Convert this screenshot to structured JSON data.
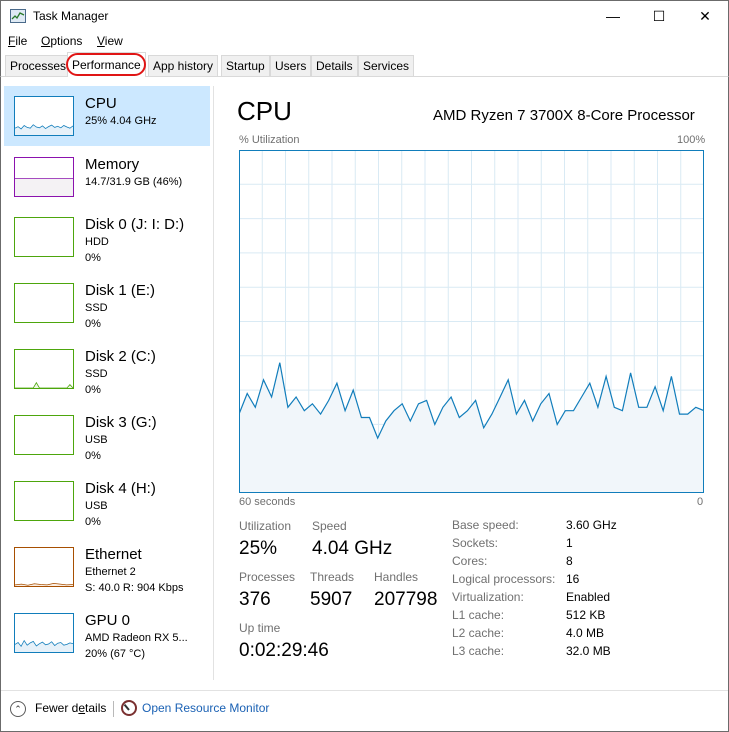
{
  "window": {
    "title": "Task Manager",
    "icon": "task-manager-icon",
    "minimize_glyph": "—",
    "maximize_glyph": "☐",
    "close_glyph": "✕"
  },
  "menu": [
    {
      "ul": "F",
      "rest": "ile"
    },
    {
      "ul": "O",
      "rest": "ptions"
    },
    {
      "ul": "V",
      "rest": "iew"
    }
  ],
  "tabs": [
    "Processes",
    "Performance",
    "App history",
    "Startup",
    "Users",
    "Details",
    "Services"
  ],
  "active_tab": "Performance",
  "sidebar": [
    {
      "name": "CPU",
      "line1": "25% 4.04 GHz",
      "line2": "",
      "color": "#117dbb"
    },
    {
      "name": "Memory",
      "line1": "14.7/31.9 GB (46%)",
      "line2": "",
      "color": "#8b12ae"
    },
    {
      "name": "Disk 0 (J: I: D:)",
      "line1": "HDD",
      "line2": "0%",
      "color": "#4da60c"
    },
    {
      "name": "Disk 1 (E:)",
      "line1": "SSD",
      "line2": "0%",
      "color": "#4da60c"
    },
    {
      "name": "Disk 2 (C:)",
      "line1": "SSD",
      "line2": "0%",
      "color": "#4da60c"
    },
    {
      "name": "Disk 3 (G:)",
      "line1": "USB",
      "line2": "0%",
      "color": "#4da60c"
    },
    {
      "name": "Disk 4 (H:)",
      "line1": "USB",
      "line2": "0%",
      "color": "#4da60c"
    },
    {
      "name": "Ethernet",
      "line1": "Ethernet 2",
      "line2": "S: 40.0 R: 904 Kbps",
      "color": "#a74f01"
    },
    {
      "name": "GPU 0",
      "line1": "AMD Radeon RX 5...",
      "line2": "20% (67 °C)",
      "color": "#117dbb"
    }
  ],
  "main": {
    "title": "CPU",
    "model": "AMD Ryzen 7 3700X 8-Core Processor",
    "util_label": "% Utilization",
    "max_label": "100%",
    "seconds_label": "60 seconds",
    "zero_label": "0",
    "accent": "#117dbb",
    "fill": "#f1f6fa",
    "grid_color": "#d9eaf4"
  },
  "stats": {
    "utilization_label": "Utilization",
    "utilization": "25%",
    "speed_label": "Speed",
    "speed": "4.04 GHz",
    "processes_label": "Processes",
    "processes": "376",
    "threads_label": "Threads",
    "threads": "5907",
    "handles_label": "Handles",
    "handles": "207798",
    "uptime_label": "Up time",
    "uptime": "0:02:29:46"
  },
  "specs": [
    {
      "label": "Base speed:",
      "value": "3.60 GHz"
    },
    {
      "label": "Sockets:",
      "value": "1"
    },
    {
      "label": "Cores:",
      "value": "8"
    },
    {
      "label": "Logical processors:",
      "value": "16"
    },
    {
      "label": "Virtualization:",
      "value": "Enabled"
    },
    {
      "label": "L1 cache:",
      "value": "512 KB"
    },
    {
      "label": "L2 cache:",
      "value": "4.0 MB"
    },
    {
      "label": "L3 cache:",
      "value": "32.0 MB"
    }
  ],
  "footer": {
    "fewer_details": "Fewer details",
    "fewer_details_underline_index": 7,
    "open_resource_monitor": "Open Resource Monitor"
  },
  "chart_data": {
    "type": "line",
    "ylim": [
      0,
      100
    ],
    "ylabel": "% Utilization",
    "xlabel": "60 seconds",
    "grid": true,
    "values": [
      23,
      29,
      25,
      33,
      28,
      38,
      25,
      28,
      24,
      26,
      23,
      27,
      32,
      24,
      30,
      22,
      22,
      16,
      21,
      24,
      26,
      21,
      26,
      27,
      20,
      25,
      28,
      22,
      24,
      27,
      19,
      23,
      28,
      33,
      23,
      27,
      21,
      26,
      29,
      20,
      24,
      24,
      28,
      32,
      25,
      34,
      25,
      24,
      35,
      25,
      25,
      31,
      24,
      34,
      23,
      23,
      25,
      24
    ]
  },
  "sparklines": {
    "cpu": [
      18,
      22,
      16,
      25,
      20,
      18,
      27,
      21,
      19,
      24,
      17,
      22,
      26,
      20,
      23,
      19,
      25,
      21,
      18,
      24
    ],
    "memory": 46,
    "ethernet": [
      3,
      5,
      2,
      6,
      4,
      3,
      7,
      5,
      3,
      4
    ],
    "gpu": [
      20,
      25,
      15,
      30,
      18,
      24,
      28,
      16,
      22,
      26,
      19,
      21,
      27,
      17,
      23,
      25,
      18,
      20,
      24,
      22
    ],
    "disk2": [
      0,
      0,
      0,
      0,
      0,
      0,
      0,
      14,
      0,
      0,
      0,
      0,
      0,
      0,
      0,
      0,
      0,
      0,
      9,
      0
    ]
  }
}
